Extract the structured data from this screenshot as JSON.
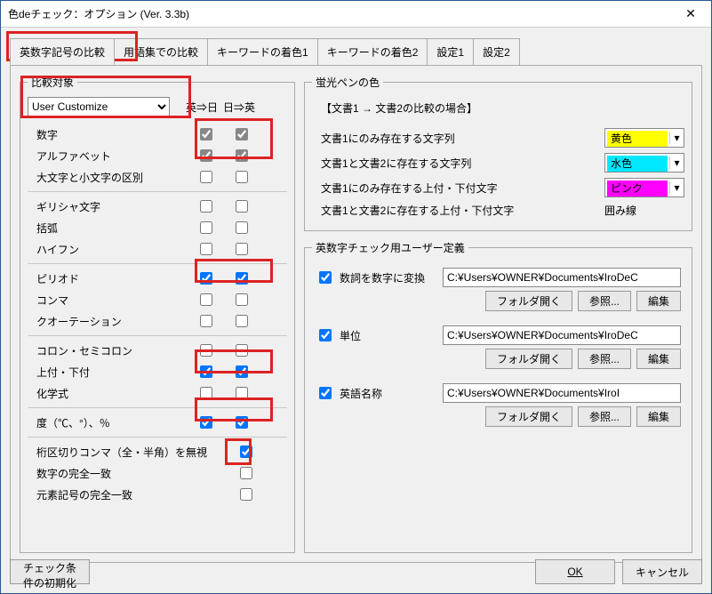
{
  "window": {
    "title": "色deチェック：オプション (Ver. 3.3b)"
  },
  "tabs": [
    "英数字記号の比較",
    "用語集での比較",
    "キーワードの着色1",
    "キーワードの着色2",
    "設定1",
    "設定2"
  ],
  "compare_target": {
    "legend": "比較対象",
    "mode": "User Customize",
    "col1": "英⇒日",
    "col2": "日⇒英",
    "rows": [
      {
        "label": "数字",
        "c1": true,
        "c2": true,
        "g": true
      },
      {
        "label": "アルファベット",
        "c1": true,
        "c2": true,
        "g": true
      },
      {
        "label": "大文字と小文字の区別",
        "c1": false,
        "c2": false
      },
      {
        "sep": true
      },
      {
        "label": "ギリシャ文字",
        "c1": false,
        "c2": false
      },
      {
        "label": "括弧",
        "c1": false,
        "c2": false
      },
      {
        "label": "ハイフン",
        "c1": false,
        "c2": false
      },
      {
        "sep": true
      },
      {
        "label": "ピリオド",
        "c1": true,
        "c2": true
      },
      {
        "label": "コンマ",
        "c1": false,
        "c2": false
      },
      {
        "label": "クオーテーション",
        "c1": false,
        "c2": false
      },
      {
        "sep": true
      },
      {
        "label": "コロン・セミコロン",
        "c1": false,
        "c2": false
      },
      {
        "label": "上付・下付",
        "c1": true,
        "c2": true
      },
      {
        "label": "化学式",
        "c1": false,
        "c2": false
      },
      {
        "sep": true
      },
      {
        "label": "度（℃、°）、％",
        "c1": true,
        "c2": true
      },
      {
        "sep": true
      },
      {
        "label": "桁区切りコンマ（全・半角）を無視",
        "c1": true,
        "single": true
      },
      {
        "label": "数字の完全一致",
        "c1": false,
        "single": true
      },
      {
        "label": "元素記号の完全一致",
        "c1": false,
        "single": true
      }
    ]
  },
  "highlighter": {
    "legend": "蛍光ペンの色",
    "note": "【文書1 → 文書2の比較の場合】",
    "rows": [
      {
        "text": "文書1にのみ存在する文字列",
        "name": "黄色",
        "color": "#ffff00"
      },
      {
        "text": "文書1と文書2に存在する文字列",
        "name": "水色",
        "color": "#00e8ff"
      },
      {
        "text": "文書1にのみ存在する上付・下付文字",
        "name": "ピンク",
        "color": "#ff00ff"
      },
      {
        "text": "文書1と文書2に存在する上付・下付文字",
        "name": "囲み線",
        "color": ""
      }
    ]
  },
  "userdef": {
    "legend": "英数字チェック用ユーザー定義",
    "items": [
      {
        "on": true,
        "label": "数詞を数字に変換",
        "path": "C:¥Users¥OWNER¥Documents¥IroDeC"
      },
      {
        "on": true,
        "label": "単位",
        "path": "C:¥Users¥OWNER¥Documents¥IroDeC"
      },
      {
        "on": true,
        "label": "英語名称",
        "path": "C:¥Users¥OWNER¥Documents¥IroI"
      }
    ],
    "btn_folder": "フォルダ開く",
    "btn_browse": "参照...",
    "btn_edit": "編集"
  },
  "buttons": {
    "init": "チェック条件の初期化",
    "ok": "OK",
    "cancel": "キャンセル"
  }
}
